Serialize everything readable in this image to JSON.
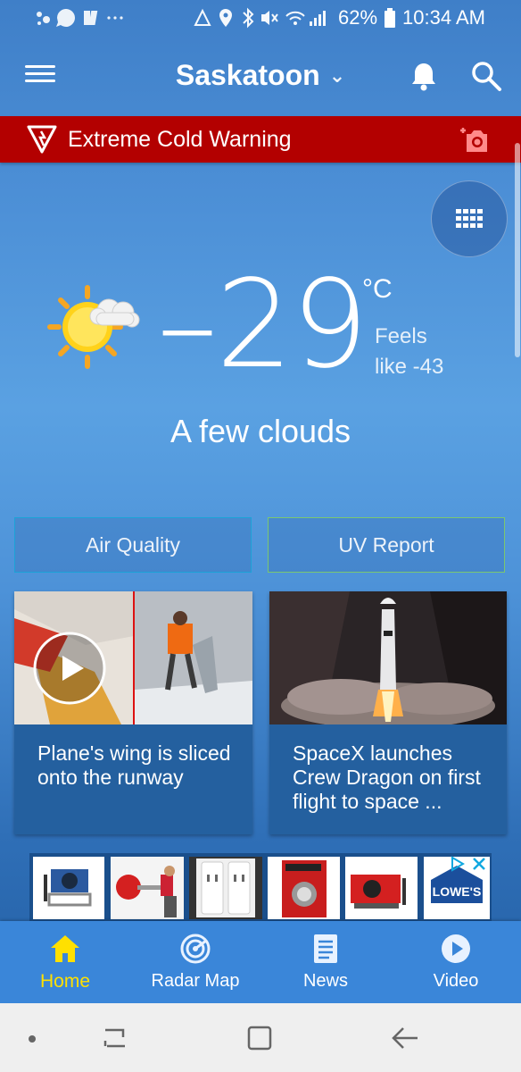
{
  "status_bar": {
    "battery": "62%",
    "time": "10:34 AM"
  },
  "header": {
    "city": "Saskatoon"
  },
  "alert": {
    "text": "Extreme Cold Warning"
  },
  "current": {
    "temperature": "29",
    "unit": "°C",
    "feels_label": "Feels",
    "feels_value": "like -43",
    "description": "A few clouds"
  },
  "reports": {
    "air_quality": "Air Quality",
    "uv": "UV Report"
  },
  "news": [
    {
      "title": "Plane's wing is sliced onto the runway",
      "has_video": true
    },
    {
      "title": "SpaceX launches Crew Dragon on first flight to space ...",
      "has_video": false
    }
  ],
  "ad": {
    "brand": "LOWE'S"
  },
  "bottom_nav": {
    "items": [
      {
        "label": "Home",
        "icon": "home-icon",
        "active": true
      },
      {
        "label": "Radar Map",
        "icon": "radar-icon",
        "active": false
      },
      {
        "label": "News",
        "icon": "news-icon",
        "active": false
      },
      {
        "label": "Video",
        "icon": "video-play-icon",
        "active": false
      }
    ]
  },
  "colors": {
    "alert_red": "#b30000",
    "active_nav": "#ffe000",
    "nav_bg": "#3a86d9"
  }
}
